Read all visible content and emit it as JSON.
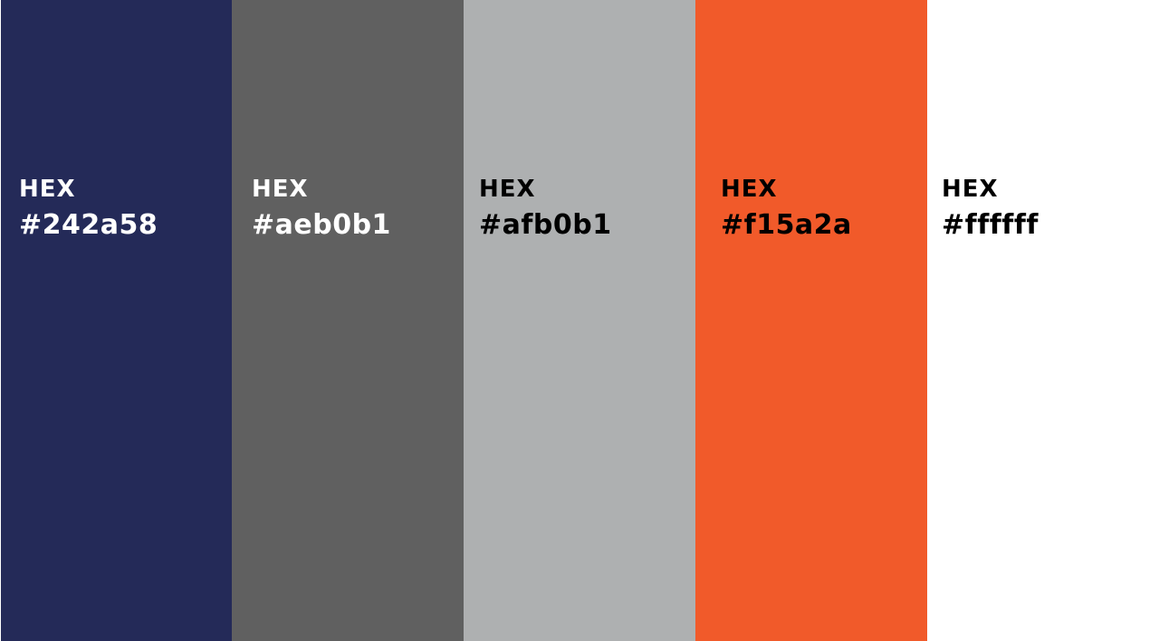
{
  "swatches": [
    {
      "heading": "HEX",
      "code": "#242a58",
      "fill": "#242a58",
      "text_color": "#ffffff"
    },
    {
      "heading": "HEX",
      "code": "#aeb0b1",
      "fill": "#606060",
      "text_color": "#ffffff"
    },
    {
      "heading": "HEX",
      "code": "#afb0b1",
      "fill": "#aeb0b1",
      "text_color": "#000000"
    },
    {
      "heading": "HEX",
      "code": "#f15a2a",
      "fill": "#f15a2a",
      "text_color": "#000000"
    },
    {
      "heading": "HEX",
      "code": "#ffffff",
      "fill": "#ffffff",
      "text_color": "#000000"
    }
  ]
}
